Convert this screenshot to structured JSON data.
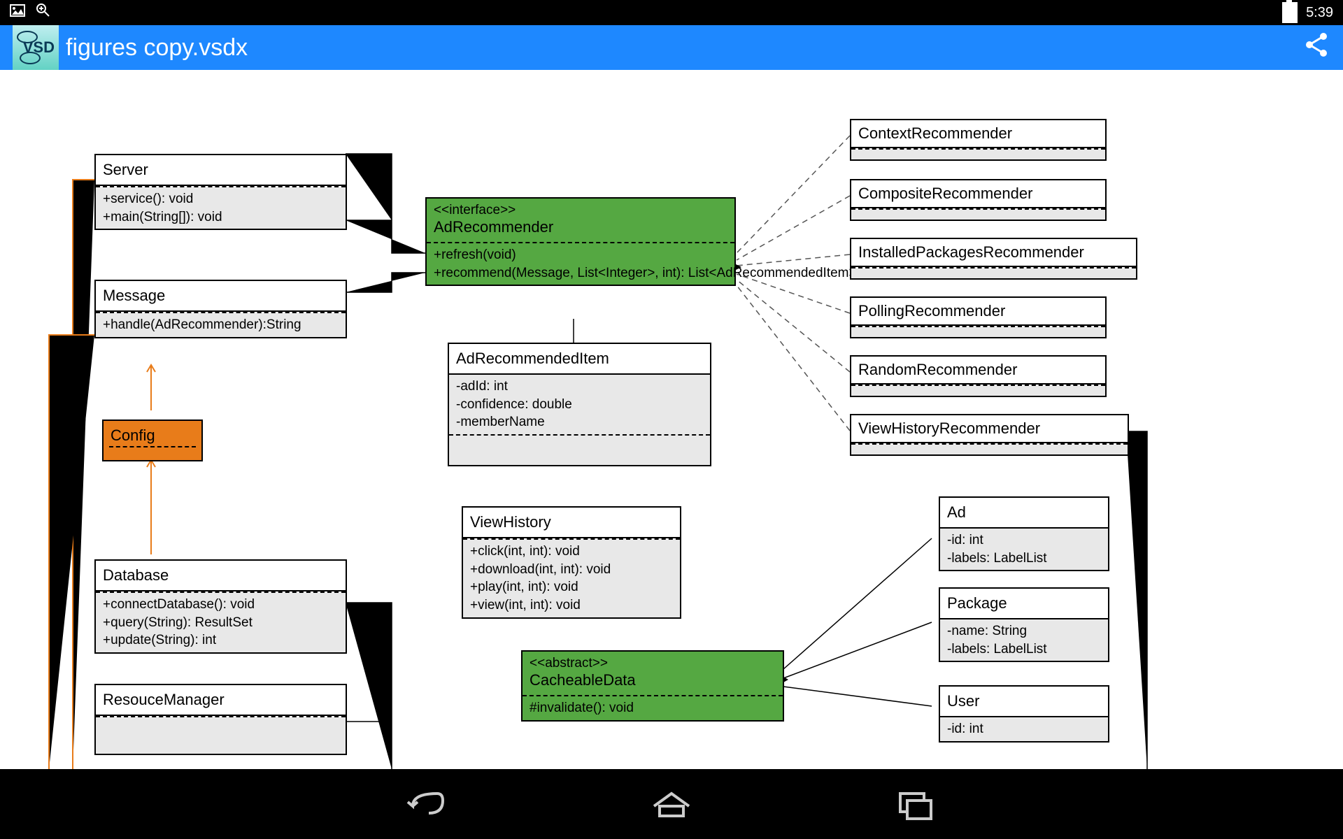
{
  "status": {
    "time": "5:39"
  },
  "title": "figures copy.vsdx",
  "classes": {
    "server": {
      "name": "Server",
      "methods": "+service(): void\n+main(String[]): void"
    },
    "message": {
      "name": "Message",
      "methods": "+handle(AdRecommender):String"
    },
    "config": {
      "name": "Config"
    },
    "database": {
      "name": "Database",
      "methods": "+connectDatabase(): void\n+query(String): ResultSet\n+update(String): int"
    },
    "resmgr": {
      "name": "ResouceManager"
    },
    "adrec": {
      "stereo": "<<interface>>",
      "name": "AdRecommender",
      "methods": "+refresh(void)\n+recommend(Message, List<Integer>, int): List<AdRecommendedItem>"
    },
    "adrecitem": {
      "name": "AdRecommendedItem",
      "attrs": "-adId: int\n-confidence: double\n-memberName"
    },
    "viewhist": {
      "name": "ViewHistory",
      "methods": "+click(int, int): void\n+download(int, int): void\n+play(int, int): void\n+view(int, int): void"
    },
    "cacheable": {
      "stereo": "<<abstract>>",
      "name": "CacheableData",
      "methods": "#invalidate(): void"
    },
    "ctxrec": {
      "name": "ContextRecommender"
    },
    "comprec": {
      "name": "CompositeRecommender"
    },
    "instrec": {
      "name": "InstalledPackagesRecommender"
    },
    "pollrec": {
      "name": "PollingRecommender"
    },
    "randrec": {
      "name": "RandomRecommender"
    },
    "vhrec": {
      "name": "ViewHistoryRecommender"
    },
    "ad": {
      "name": "Ad",
      "attrs": "-id: int\n-labels: LabelList"
    },
    "package": {
      "name": "Package",
      "attrs": "-name: String\n-labels: LabelList"
    },
    "user": {
      "name": "User",
      "attrs": "-id: int"
    }
  }
}
